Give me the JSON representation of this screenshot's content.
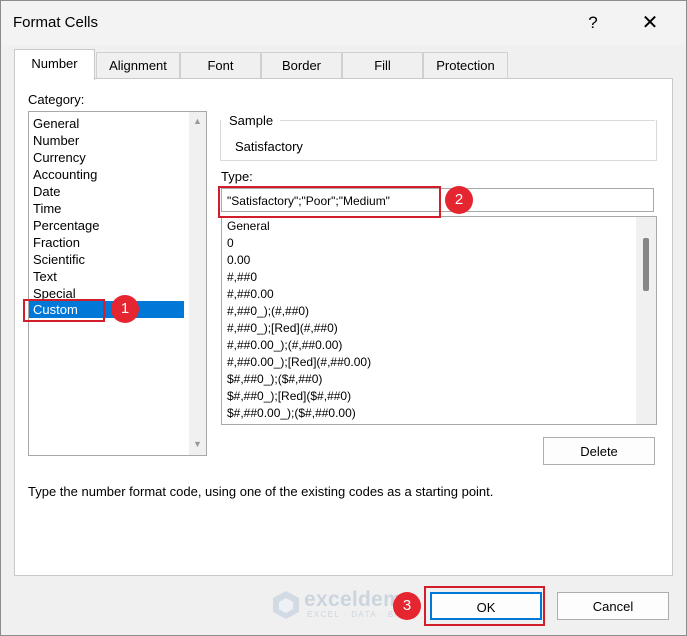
{
  "window": {
    "title": "Format Cells",
    "help": "?",
    "close": "✕"
  },
  "tabs": [
    "Number",
    "Alignment",
    "Font",
    "Border",
    "Fill",
    "Protection"
  ],
  "category": {
    "label": "Category:",
    "items": [
      "General",
      "Number",
      "Currency",
      "Accounting",
      "Date",
      "Time",
      "Percentage",
      "Fraction",
      "Scientific",
      "Text",
      "Special",
      "Custom"
    ],
    "selected": "Custom"
  },
  "sample": {
    "label": "Sample",
    "value": "Satisfactory"
  },
  "type": {
    "label": "Type:",
    "value": "\"Satisfactory\";\"Poor\";\"Medium\"",
    "formats": [
      "General",
      "0",
      "0.00",
      "#,##0",
      "#,##0.00",
      "#,##0_);(#,##0)",
      "#,##0_);[Red](#,##0)",
      "#,##0.00_);(#,##0.00)",
      "#,##0.00_);[Red](#,##0.00)",
      "$#,##0_);($#,##0)",
      "$#,##0_);[Red]($#,##0)",
      "$#,##0.00_);($#,##0.00)"
    ]
  },
  "buttons": {
    "delete": "Delete",
    "ok": "OK",
    "cancel": "Cancel"
  },
  "description": "Type the number format code, using one of the existing codes as a starting point.",
  "annotations": {
    "step1": "1",
    "step2": "2",
    "step3": "3",
    "color": "#e5252f"
  },
  "watermark": {
    "name": "exceldemy",
    "tagline": "EXCEL · DATA · BI"
  }
}
